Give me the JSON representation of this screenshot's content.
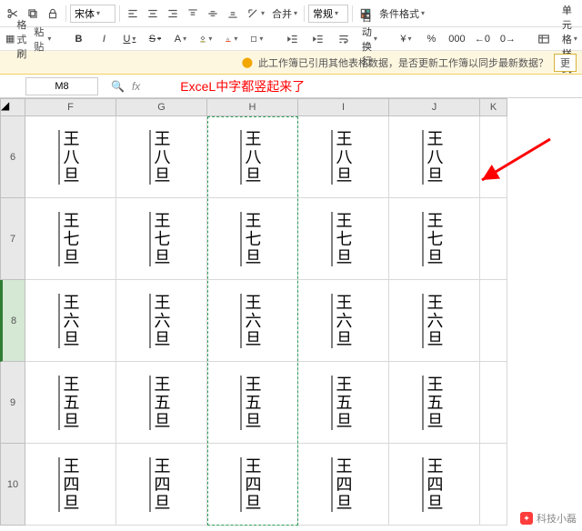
{
  "ribbon": {
    "fs_brush": "格式刷",
    "paste": "粘贴",
    "font_name": "宋体",
    "bold": "B",
    "italic": "I",
    "underline": "U",
    "strike": "S",
    "superscript": "A",
    "merge": "合并",
    "auto_wrap": "自动换行",
    "normal": "常规",
    "currency": "¥",
    "percent": "%",
    "comma_style": "000",
    "dec_inc": "←0",
    "dec_dec": "0→",
    "cond_fmt": "条件格式",
    "cell_style": "单元格样式"
  },
  "panel": {
    "fs_brush": "格式刷",
    "paste": "粘贴"
  },
  "warning": {
    "text": "此工作簿已引用其他表格数据，是否更新工作簿以同步最新数据？",
    "btn": "更"
  },
  "formula": {
    "cellref": "M8",
    "annotation": "ExceL中字都竖起来了"
  },
  "grid": {
    "cols": [
      "F",
      "G",
      "H",
      "I",
      "J",
      "K"
    ],
    "rows": [
      "6",
      "7",
      "8",
      "9",
      "10"
    ],
    "active_row": "8",
    "data": [
      [
        "王八旦",
        "王八旦",
        "王八旦",
        "王八旦",
        "王八旦"
      ],
      [
        "王七旦",
        "王七旦",
        "王七旦",
        "王七旦",
        "王七旦"
      ],
      [
        "王六旦",
        "王六旦",
        "王六旦",
        "王六旦",
        "王六旦"
      ],
      [
        "王五旦",
        "王五旦",
        "王五旦",
        "王五旦",
        "王五旦"
      ],
      [
        "王四旦",
        "王四旦",
        "王四旦",
        "王四旦",
        "王四旦"
      ]
    ]
  },
  "watermark": {
    "author": "科技小磊"
  }
}
